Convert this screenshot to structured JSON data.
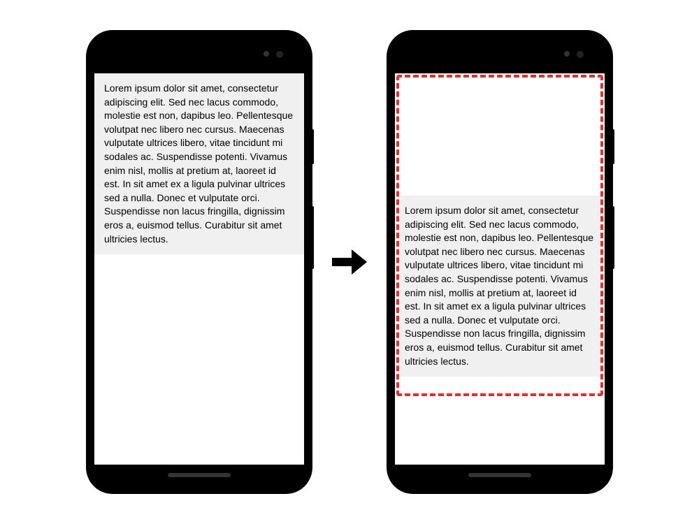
{
  "lorem_text": "Lorem ipsum dolor sit amet, consectetur adipiscing elit. Sed nec lacus commodo, molestie est non, dapibus leo. Pellentesque volutpat nec libero nec cursus. Maecenas vulputate ultrices libero, vitae tincidunt mi sodales ac. Suspendisse potenti. Vivamus enim nisl, mollis at pretium at, laoreet id est. In sit amet ex a ligula pulvinar ultrices sed a nulla. Donec et vulputate orci. Suspendisse non lacus fringilla, dignissim eros a, euismod tellus. Curabitur sit amet ultricies lectus.",
  "overlay_color": "#e03030"
}
